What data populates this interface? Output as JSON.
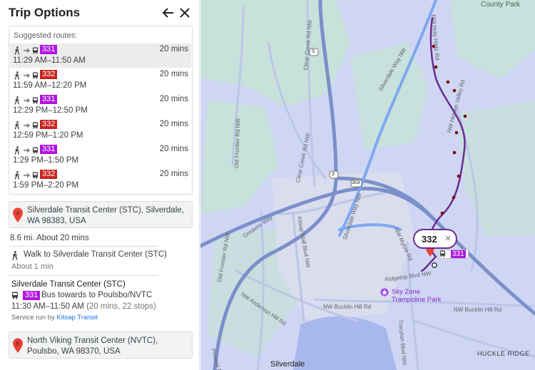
{
  "header": {
    "title": "Trip Options",
    "back_icon": "arrow-left-icon",
    "close_icon": "close-icon"
  },
  "colors": {
    "route_331": "#b016e0",
    "route_332": "#c8261f",
    "route_line": "#6a2c91",
    "map_bg": "#cfd6f4",
    "highway": "#7b8fc9",
    "water": "#a9b8ec",
    "park": "#c6e3d6"
  },
  "routes": {
    "caption": "Suggested routes:",
    "items": [
      {
        "route": "331",
        "color": "#b016e0",
        "duration": "20 mins",
        "times": "11:29 AM–11:50 AM",
        "selected": true
      },
      {
        "route": "332",
        "color": "#c8261f",
        "duration": "20 mins",
        "times": "11:59 AM–12:20 PM",
        "selected": false
      },
      {
        "route": "331",
        "color": "#b016e0",
        "duration": "20 mins",
        "times": "12:29 PM–12:50 PM",
        "selected": false
      },
      {
        "route": "332",
        "color": "#c8261f",
        "duration": "20 mins",
        "times": "12:59 PM–1:20 PM",
        "selected": false
      },
      {
        "route": "331",
        "color": "#b016e0",
        "duration": "20 mins",
        "times": "1:29 PM–1:50 PM",
        "selected": false
      },
      {
        "route": "332",
        "color": "#c8261f",
        "duration": "20 mins",
        "times": "1:59 PM–2:20 PM",
        "selected": false
      }
    ]
  },
  "origin": {
    "marker": "A",
    "address": "Silverdale Transit Center (STC), Silverdale, WA 98383, USA"
  },
  "summary": "8.6 mi. About 20 mins",
  "walk_step": {
    "label": "Walk to Silverdale Transit Center (STC)",
    "duration": "About 1 min"
  },
  "transit_step": {
    "stop": "Silverdale Transit Center (STC)",
    "route": "331",
    "description": "Bus towards to Poulsbo/NVTC",
    "times": "11:30 AM–11:50 AM",
    "details": "(20 mins, 22 stops)",
    "service_prefix": "Service run by",
    "agency": "Kitsap Transit"
  },
  "destination": {
    "marker": "B",
    "address": "North Viking Transit Center (NVTC), Poulsbo, WA 98370, USA"
  },
  "map": {
    "popup_route": "332",
    "popup_close": "×",
    "badge_route": "331",
    "labels": {
      "county_park": "County Park",
      "silverdale_way_top": "Silverdale Way NW",
      "clear_creek_top": "Clear Creek Rd NW",
      "clear_creek_mid": "Clear Creek Rd NW",
      "old_frontier_top": "Old Frontier Rd NW",
      "old_frontier_bottom": "Old Frontier Rd NW",
      "greaves_way": "Greaves Way",
      "kitsap_mall": "Kitsap Mall Blvd NW",
      "silverdale_way_mid": "Silverdale Way NW",
      "nw_myhre": "NW Myhre Rd",
      "ridgetop": "Ridgetop Blvd NW",
      "nw_anderson": "NW Anderson Hill Rd",
      "nw_bucklin_mid": "NW Bucklin Hill Rd",
      "nw_bucklin_right": "NW Bucklin Hill Rd",
      "tracyton": "Tracyton Blvd NW",
      "provost": "Provost Rd",
      "nw_hintz": "NW Holy Hintz Rd",
      "nw_hidden": "NW Hidden Valley Rd",
      "silverdale_town": "Silverdale",
      "huckle_ridge": "HUCKLE RIDGE",
      "sky_zone": "Sky Zone Trampoline Park",
      "hwy_3_top": "3",
      "hwy_3_mid": "3",
      "hwy_303": "303"
    }
  }
}
